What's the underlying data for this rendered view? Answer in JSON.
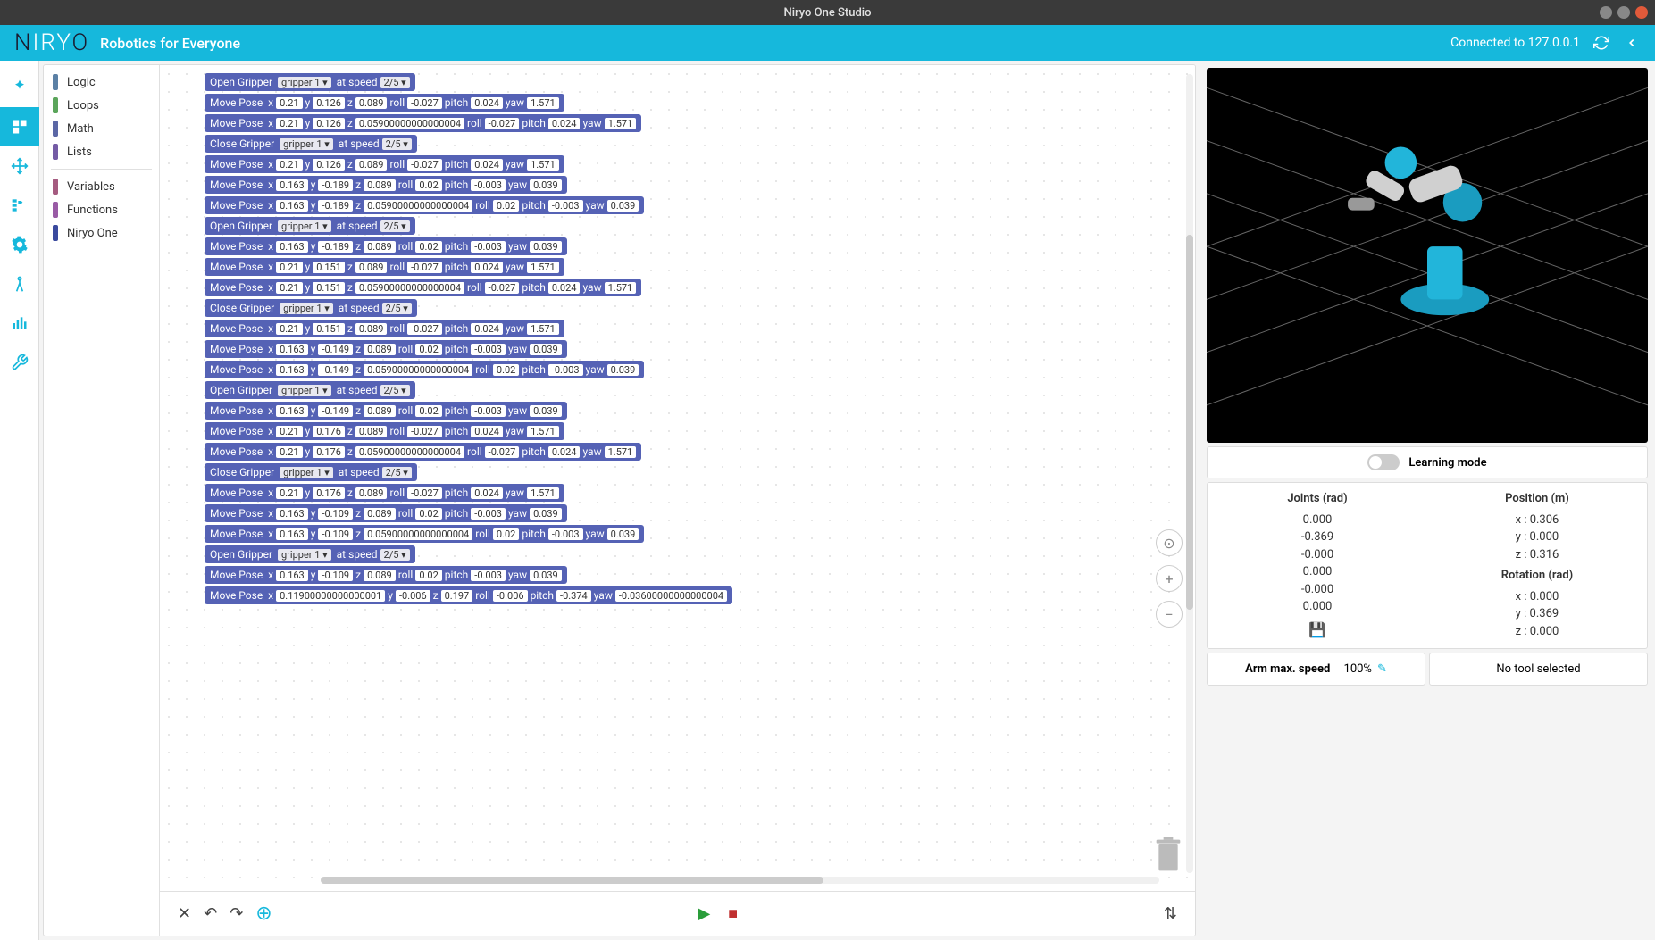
{
  "window": {
    "title": "Niryo One Studio"
  },
  "header": {
    "logo_pre": "N",
    "logo_mid": "IRY",
    "logo_post": "O",
    "tagline": "Robotics for Everyone",
    "connection": "Connected to 127.0.0.1"
  },
  "categories": [
    {
      "label": "Logic",
      "color": "#5b80a5"
    },
    {
      "label": "Loops",
      "color": "#5ba55b"
    },
    {
      "label": "Math",
      "color": "#5b67a5"
    },
    {
      "label": "Lists",
      "color": "#745ba5"
    },
    {
      "label": "Variables",
      "color": "#a55b80"
    },
    {
      "label": "Functions",
      "color": "#995ba5"
    },
    {
      "label": "Niryo One",
      "color": "#3a4a9e"
    }
  ],
  "blocks": [
    {
      "type": "gripper",
      "action": "Open Gripper",
      "tool": "gripper 1 ▾",
      "speed": "2/5 ▾"
    },
    {
      "type": "pose",
      "x": "0.21",
      "y": "0.126",
      "z": "0.089",
      "roll": "-0.027",
      "pitch": "0.024",
      "yaw": "1.571"
    },
    {
      "type": "pose",
      "x": "0.21",
      "y": "0.126",
      "z": "0.05900000000000004",
      "roll": "-0.027",
      "pitch": "0.024",
      "yaw": "1.571"
    },
    {
      "type": "gripper",
      "action": "Close Gripper",
      "tool": "gripper 1 ▾",
      "speed": "2/5 ▾"
    },
    {
      "type": "pose",
      "x": "0.21",
      "y": "0.126",
      "z": "0.089",
      "roll": "-0.027",
      "pitch": "0.024",
      "yaw": "1.571"
    },
    {
      "type": "pose",
      "x": "0.163",
      "y": "-0.189",
      "z": "0.089",
      "roll": "0.02",
      "pitch": "-0.003",
      "yaw": "0.039"
    },
    {
      "type": "pose",
      "x": "0.163",
      "y": "-0.189",
      "z": "0.05900000000000004",
      "roll": "0.02",
      "pitch": "-0.003",
      "yaw": "0.039"
    },
    {
      "type": "gripper",
      "action": "Open Gripper",
      "tool": "gripper 1 ▾",
      "speed": "2/5 ▾"
    },
    {
      "type": "pose",
      "x": "0.163",
      "y": "-0.189",
      "z": "0.089",
      "roll": "0.02",
      "pitch": "-0.003",
      "yaw": "0.039"
    },
    {
      "type": "pose",
      "x": "0.21",
      "y": "0.151",
      "z": "0.089",
      "roll": "-0.027",
      "pitch": "0.024",
      "yaw": "1.571"
    },
    {
      "type": "pose",
      "x": "0.21",
      "y": "0.151",
      "z": "0.05900000000000004",
      "roll": "-0.027",
      "pitch": "0.024",
      "yaw": "1.571"
    },
    {
      "type": "gripper",
      "action": "Close Gripper",
      "tool": "gripper 1 ▾",
      "speed": "2/5 ▾"
    },
    {
      "type": "pose",
      "x": "0.21",
      "y": "0.151",
      "z": "0.089",
      "roll": "-0.027",
      "pitch": "0.024",
      "yaw": "1.571"
    },
    {
      "type": "pose",
      "x": "0.163",
      "y": "-0.149",
      "z": "0.089",
      "roll": "0.02",
      "pitch": "-0.003",
      "yaw": "0.039"
    },
    {
      "type": "pose",
      "x": "0.163",
      "y": "-0.149",
      "z": "0.05900000000000004",
      "roll": "0.02",
      "pitch": "-0.003",
      "yaw": "0.039"
    },
    {
      "type": "gripper",
      "action": "Open Gripper",
      "tool": "gripper 1 ▾",
      "speed": "2/5 ▾"
    },
    {
      "type": "pose",
      "x": "0.163",
      "y": "-0.149",
      "z": "0.089",
      "roll": "0.02",
      "pitch": "-0.003",
      "yaw": "0.039"
    },
    {
      "type": "pose",
      "x": "0.21",
      "y": "0.176",
      "z": "0.089",
      "roll": "-0.027",
      "pitch": "0.024",
      "yaw": "1.571"
    },
    {
      "type": "pose",
      "x": "0.21",
      "y": "0.176",
      "z": "0.05900000000000004",
      "roll": "-0.027",
      "pitch": "0.024",
      "yaw": "1.571"
    },
    {
      "type": "gripper",
      "action": "Close Gripper",
      "tool": "gripper 1 ▾",
      "speed": "2/5 ▾"
    },
    {
      "type": "pose",
      "x": "0.21",
      "y": "0.176",
      "z": "0.089",
      "roll": "-0.027",
      "pitch": "0.024",
      "yaw": "1.571"
    },
    {
      "type": "pose",
      "x": "0.163",
      "y": "-0.109",
      "z": "0.089",
      "roll": "0.02",
      "pitch": "-0.003",
      "yaw": "0.039"
    },
    {
      "type": "pose",
      "x": "0.163",
      "y": "-0.109",
      "z": "0.05900000000000004",
      "roll": "0.02",
      "pitch": "-0.003",
      "yaw": "0.039"
    },
    {
      "type": "gripper",
      "action": "Open Gripper",
      "tool": "gripper 1 ▾",
      "speed": "2/5 ▾"
    },
    {
      "type": "pose",
      "x": "0.163",
      "y": "-0.109",
      "z": "0.089",
      "roll": "0.02",
      "pitch": "-0.003",
      "yaw": "0.039"
    },
    {
      "type": "pose",
      "x": "0.11900000000000001",
      "y": "-0.006",
      "z": "0.197",
      "roll": "-0.006",
      "pitch": "-0.374",
      "yaw": "-0.03600000000000004"
    }
  ],
  "learn_mode_label": "Learning mode",
  "status": {
    "joints_title": "Joints (rad)",
    "joints": [
      "0.000",
      "-0.369",
      "-0.000",
      "0.000",
      "-0.000",
      "0.000"
    ],
    "position_title": "Position (m)",
    "position": [
      "x : 0.306",
      "y : 0.000",
      "z : 0.316"
    ],
    "rotation_title": "Rotation (rad)",
    "rotation": [
      "x : 0.000",
      "y : 0.369",
      "z : 0.000"
    ]
  },
  "speed": {
    "label": "Arm max. speed",
    "value": "100%"
  },
  "tool": {
    "label": "No tool selected"
  },
  "pose_labels": {
    "cmd": "Move Pose",
    "x": "x",
    "y": "y",
    "z": "z",
    "roll": "roll",
    "pitch": "pitch",
    "yaw": "yaw",
    "atspeed": "at speed"
  }
}
